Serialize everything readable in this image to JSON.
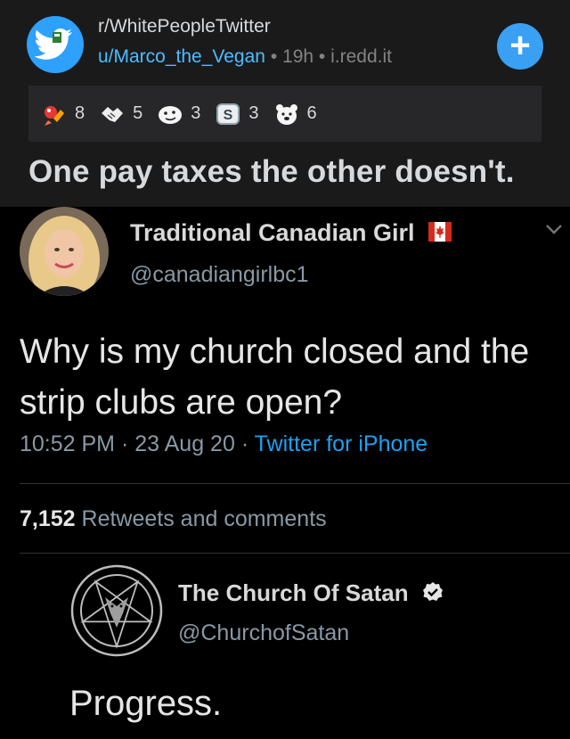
{
  "post": {
    "subreddit": "r/WhitePeopleTwitter",
    "user": "u/Marco_the_Vegan",
    "separator": "•",
    "age": "19h",
    "domain": "i.redd.it",
    "join_label": "+",
    "title": "One pay taxes the other doesn't.",
    "awards": [
      {
        "icon": "rocket-like-icon",
        "count": "8"
      },
      {
        "icon": "handshake-icon",
        "count": "5"
      },
      {
        "icon": "smirk-face-icon",
        "count": "3"
      },
      {
        "icon": "silver-s-icon",
        "count": "3"
      },
      {
        "icon": "bear-icon",
        "count": "6"
      }
    ]
  },
  "tweet": {
    "display_name": "Traditional Canadian Girl",
    "handle": "@canadiangirlbc1",
    "text": "Why is my church closed and the strip clubs are open?",
    "time": "10:52 PM",
    "date": "23 Aug 20",
    "source": "Twitter for iPhone",
    "dot": "·",
    "retweets_count": "7,152",
    "retweets_label": "Retweets and comments"
  },
  "reply": {
    "display_name": "The Church Of Satan",
    "handle": "@ChurchofSatan",
    "text": "Progress."
  },
  "colors": {
    "reddit_bg": "#1a1a1b",
    "link_blue": "#4fbcff",
    "twitter_blue": "#1da1f2",
    "muted": "#8899a6"
  }
}
